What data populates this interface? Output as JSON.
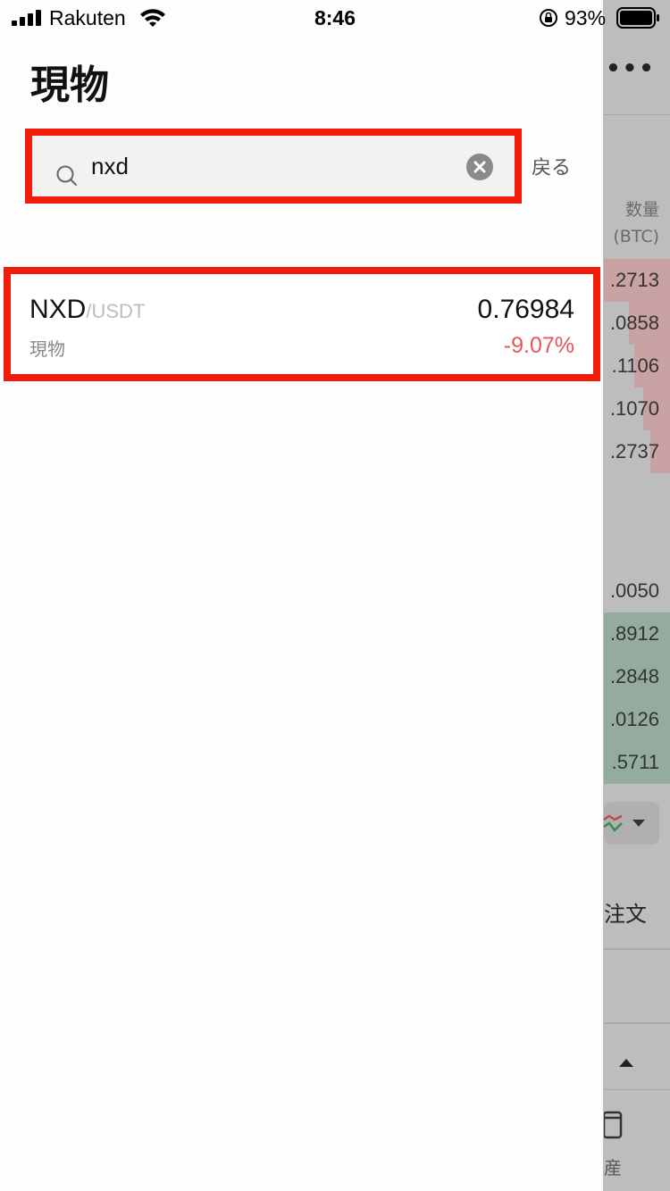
{
  "status_bar": {
    "carrier": "Rakuten",
    "time": "8:46",
    "battery_percent": "93%"
  },
  "drawer": {
    "title": "現物",
    "search": {
      "value": "nxd",
      "back_label": "戻る"
    },
    "results": [
      {
        "base": "NXD",
        "quote": "/USDT",
        "market": "現物",
        "price": "0.76984",
        "change": "-9.07%",
        "change_color": "#e8565a"
      }
    ]
  },
  "background_screen": {
    "quantity_label": "数量",
    "quantity_unit": "(BTC)",
    "asks": [
      ".2713",
      ".0858",
      ".1106",
      ".1070",
      ".2737"
    ],
    "mid": ".0050",
    "bids": [
      ".8912",
      ".2848",
      ".0126",
      ".5711"
    ],
    "order_label": "注文",
    "assets_label": "産"
  },
  "colors": {
    "highlight_border": "#f11d0a",
    "ask_fill": "#c9a2a3",
    "bid_fill": "#93ac9f"
  }
}
